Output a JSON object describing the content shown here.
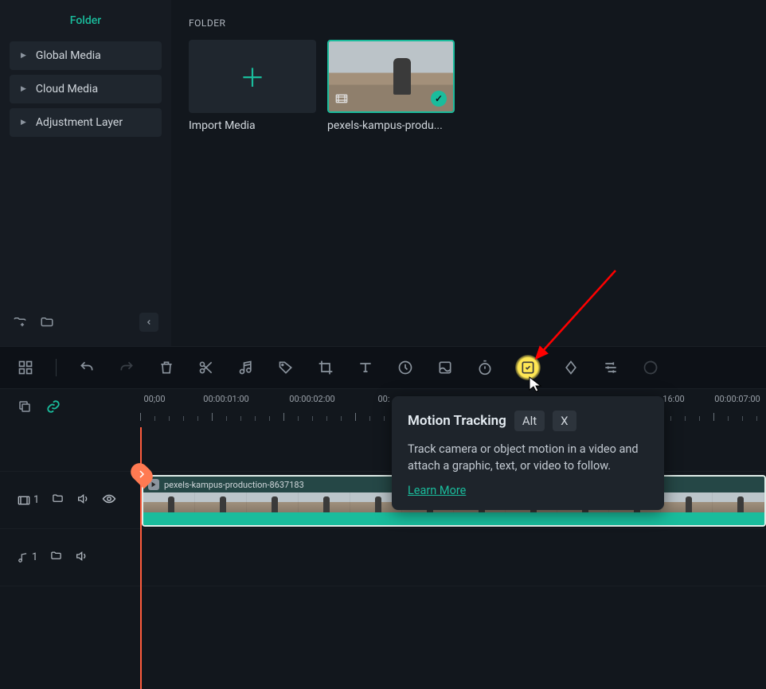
{
  "sidebar": {
    "title": "Folder",
    "items": [
      {
        "label": "Global Media"
      },
      {
        "label": "Cloud Media"
      },
      {
        "label": "Adjustment Layer"
      }
    ]
  },
  "media_panel": {
    "section_label": "FOLDER",
    "import_label": "Import Media",
    "clip_name": "pexels-kampus-produ..."
  },
  "tooltip": {
    "title": "Motion Tracking",
    "key1": "Alt",
    "key2": "X",
    "description": "Track camera or object motion in a video and attach a graphic, text, or video to follow.",
    "link": "Learn More"
  },
  "timeline": {
    "timestamps": [
      "00;00",
      "00:00:01:00",
      "00:00:02:00",
      "00:",
      "16:00",
      "00:00:07:00"
    ],
    "clip_label": "pexels-kampus-production-8637183",
    "video_track_num": "1",
    "audio_track_num": "1"
  }
}
